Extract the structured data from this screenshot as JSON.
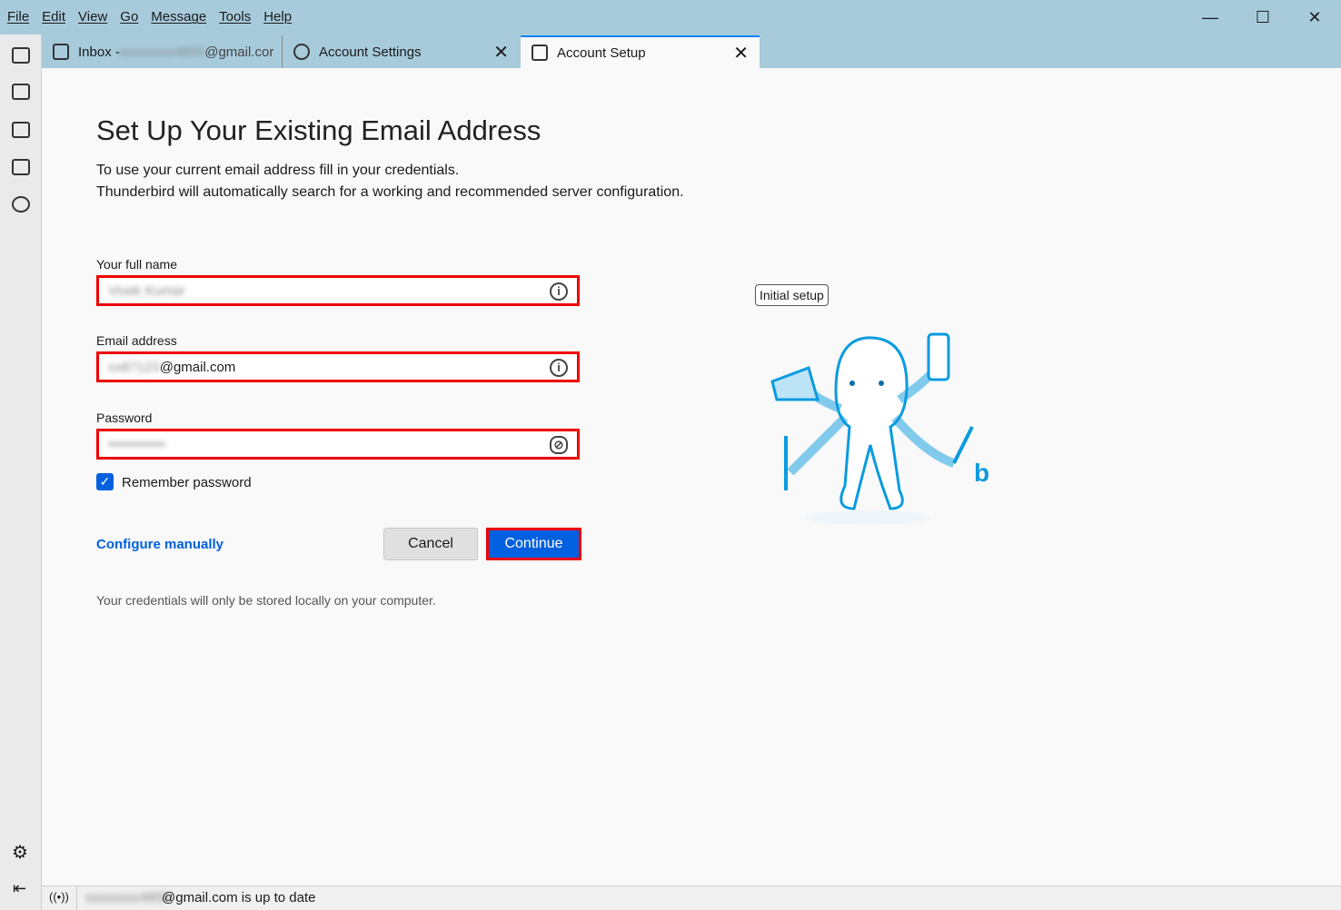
{
  "menu": [
    "File",
    "Edit",
    "View",
    "Go",
    "Message",
    "Tools",
    "Help"
  ],
  "tabs": [
    {
      "label": "Inbox - ",
      "blurred": "xxxxxxxx4855",
      "suffix": "@gmail.cor"
    },
    {
      "label": "Account Settings"
    },
    {
      "label": "Account Setup"
    }
  ],
  "page": {
    "title": "Set Up Your Existing Email Address",
    "desc1": "To use your current email address fill in your credentials.",
    "desc2": "Thunderbird will automatically search for a working and recommended server configuration."
  },
  "form": {
    "name_label": "Your full name",
    "name_value": "Vivek Kumar",
    "email_label": "Email address",
    "email_blurred": "xx87123",
    "email_suffix": "@gmail.com",
    "password_label": "Password",
    "password_value": "••••••••••••",
    "remember": "Remember password",
    "configure": "Configure manually",
    "cancel": "Cancel",
    "continue": "Continue",
    "note": "Your credentials will only be stored locally on your computer."
  },
  "illustration": {
    "badge": "Initial setup"
  },
  "status": {
    "blurred": "xxxxxxxx4855",
    "text": "@gmail.com is up to date"
  }
}
